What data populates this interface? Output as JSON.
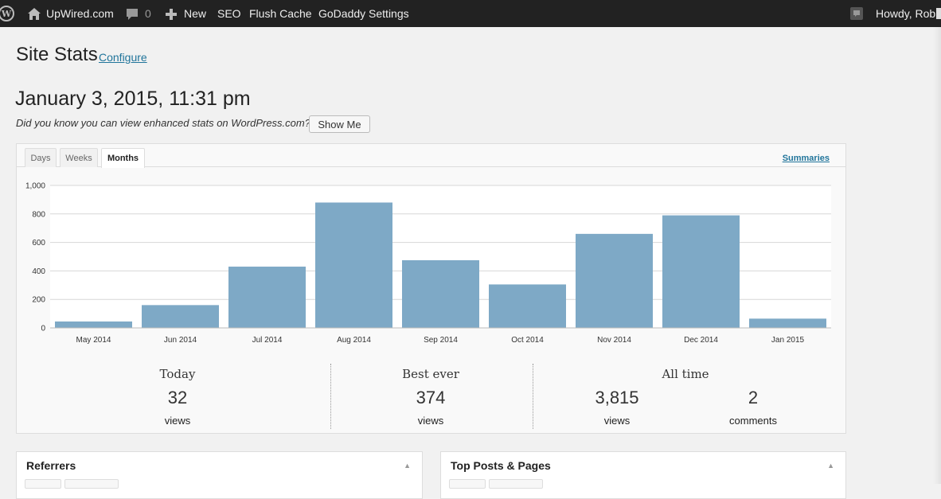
{
  "adminbar": {
    "site_name": "UpWired.com",
    "comments_count": "0",
    "new_label": "New",
    "seo_label": "SEO",
    "flush_cache_label": "Flush Cache",
    "godaddy_label": "GoDaddy Settings",
    "howdy_label": "Howdy, Rob"
  },
  "page": {
    "title": "Site Stats",
    "configure_link": "Configure",
    "date_heading": "January 3, 2015, 11:31 pm",
    "promo_text": "Did you know you can view enhanced stats on WordPress.com?",
    "show_me_label": "Show Me"
  },
  "stats": {
    "tabs": [
      {
        "label": "Days",
        "active": false
      },
      {
        "label": "Weeks",
        "active": false
      },
      {
        "label": "Months",
        "active": true
      }
    ],
    "summaries_link": "Summaries",
    "summary": {
      "today": {
        "title": "Today",
        "value": "32",
        "unit": "views"
      },
      "best_ever": {
        "title": "Best ever",
        "value": "374",
        "unit": "views"
      },
      "all_time": {
        "title": "All time",
        "views_value": "3,815",
        "views_unit": "views",
        "comments_value": "2",
        "comments_unit": "comments"
      }
    }
  },
  "chart_data": {
    "type": "bar",
    "categories": [
      "May 2014",
      "Jun 2014",
      "Jul 2014",
      "Aug 2014",
      "Sep 2014",
      "Oct 2014",
      "Nov 2014",
      "Dec 2014",
      "Jan 2015"
    ],
    "values": [
      45,
      160,
      430,
      880,
      475,
      305,
      660,
      790,
      65
    ],
    "yticks": [
      "0",
      "200",
      "400",
      "600",
      "800",
      "1,000"
    ],
    "ylim": [
      0,
      1000
    ],
    "grid": true,
    "bar_color": "#7ea9c6"
  },
  "panels": {
    "referrers_title": "Referrers",
    "top_posts_title": "Top Posts & Pages"
  },
  "colors": {
    "admin_bar": "#222222",
    "link": "#21759b",
    "background": "#f1f1f1"
  }
}
